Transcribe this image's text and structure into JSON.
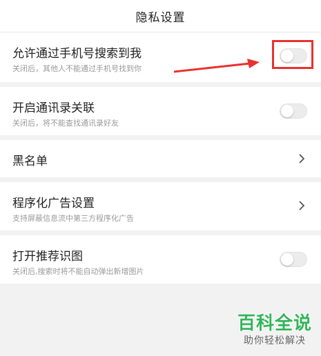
{
  "header": {
    "title": "隐私设置"
  },
  "settings": [
    {
      "label": "允许通过手机号搜索到我",
      "desc": "关闭后，其他人不能通过手机号找到你",
      "control": "toggle",
      "on": false
    },
    {
      "label": "开启通讯录关联",
      "desc": "关闭后，将不能查找通讯录好友",
      "control": "toggle",
      "on": false
    },
    {
      "label": "黑名单",
      "desc": "",
      "control": "chevron"
    },
    {
      "label": "程序化广告设置",
      "desc": "支持屏蔽信息流中第三方程序化广告",
      "control": "chevron"
    },
    {
      "label": "打开推荐识图",
      "desc": "关闭后,搜索时将不能自动弹出新增图片",
      "control": "toggle",
      "on": false
    }
  ],
  "annotation": {
    "highlight_color": "#e8322f"
  },
  "watermark": {
    "title": "百科全说",
    "subtitle": "助你轻松解决",
    "color": "#34b45a"
  }
}
